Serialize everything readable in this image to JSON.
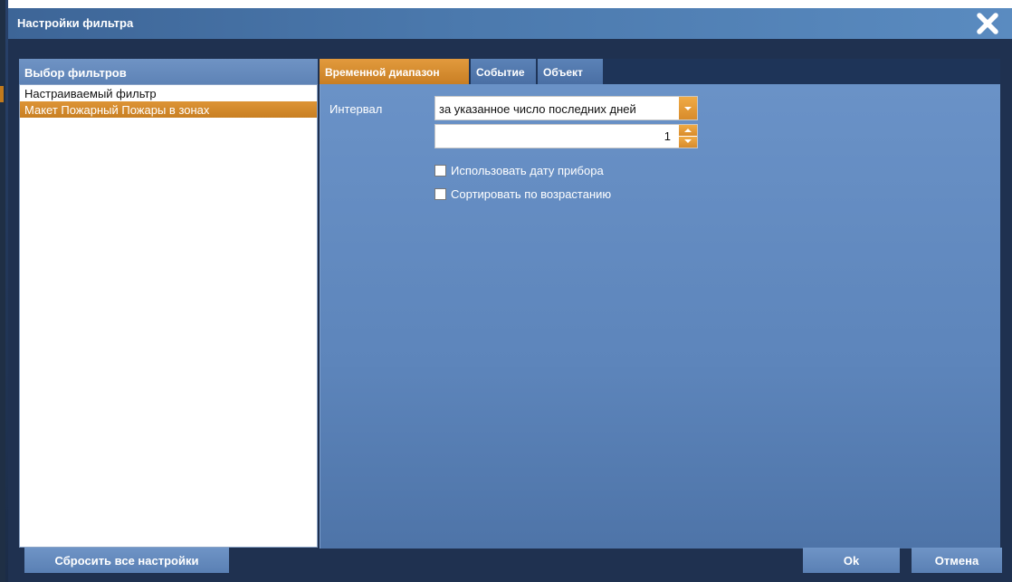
{
  "dialog": {
    "title": "Настройки фильтра",
    "close_icon": "close-x-icon"
  },
  "left": {
    "header": "Выбор фильтров",
    "items": [
      {
        "label": "Настраиваемый фильтр",
        "selected": false
      },
      {
        "label": "Макет Пожарный Пожары в зонах",
        "selected": true
      }
    ]
  },
  "tabs": [
    {
      "label": "Временной диапазон",
      "active": true
    },
    {
      "label": "Событие",
      "active": false
    },
    {
      "label": "Объект",
      "active": false
    }
  ],
  "time_range": {
    "interval_label": "Интервал",
    "interval_value": "за указанное число последних дней",
    "days_value": "1",
    "use_device_date_label": "Использовать дату прибора",
    "use_device_date_checked": false,
    "sort_ascending_label": "Сортировать по возрастанию",
    "sort_ascending_checked": false
  },
  "footer": {
    "reset_label": "Сбросить все настройки",
    "ok_label": "Ok",
    "cancel_label": "Отмена"
  },
  "colors": {
    "accent_orange": "#d88b2b",
    "title_blue": "#4b79ad",
    "panel_blue": "#5d85bb"
  }
}
